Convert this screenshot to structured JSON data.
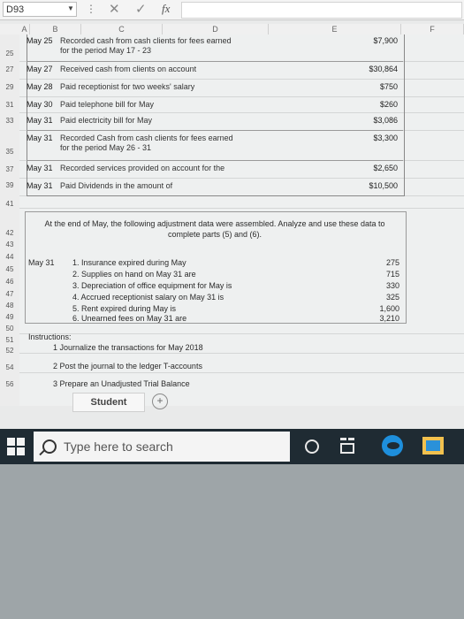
{
  "formula_bar": {
    "cell_ref": "D93",
    "dots": "⋮",
    "cancel_symbol": "✕",
    "enter_symbol": "✓",
    "fx_label": "fx"
  },
  "columns": [
    "A",
    "B",
    "C",
    "D",
    "E",
    "F"
  ],
  "row_numbers": [
    "25",
    "27",
    "29",
    "31",
    "33",
    "35",
    "37",
    "39",
    "41",
    "42",
    "43",
    "44",
    "45",
    "46",
    "47",
    "48",
    "49",
    "50",
    "51",
    "52",
    "54",
    "56"
  ],
  "transactions": [
    {
      "date": "May 25",
      "desc_1": "Recorded cash from cash clients for fees earned",
      "desc_2": "for the period May 17 - 23",
      "amount": "$7,900"
    },
    {
      "date": "May 27",
      "desc_1": "Received cash from clients on account",
      "desc_2": "",
      "amount": "$30,864"
    },
    {
      "date": "May 28",
      "desc_1": "Paid receptionist for two weeks' salary",
      "desc_2": "",
      "amount": "$750"
    },
    {
      "date": "May 30",
      "desc_1": "Paid telephone bill for May",
      "desc_2": "",
      "amount": "$260"
    },
    {
      "date": "May 31",
      "desc_1": "Paid electricity bill for May",
      "desc_2": "",
      "amount": "$3,086"
    },
    {
      "date": "May 31",
      "desc_1": "Recorded Cash from cash clients for fees earned",
      "desc_2": "for the period May 26 - 31",
      "amount": "$3,300"
    },
    {
      "date": "May 31",
      "desc_1": "Recorded services provided on account for the",
      "desc_2": "",
      "amount": "$2,650"
    },
    {
      "date": "May 31",
      "desc_1": "Paid Dividends in the amount of",
      "desc_2": "",
      "amount": "$10,500"
    }
  ],
  "adjustments": {
    "intro_1": "At the end of May, the following adjustment data were assembled. Analyze and use these data to",
    "intro_2": "complete parts (5) and (6).",
    "date": "May 31",
    "items": [
      {
        "label": "1. Insurance expired during May",
        "amount": "275"
      },
      {
        "label": "2. Supplies on hand on May 31 are",
        "amount": "715"
      },
      {
        "label": "3. Depreciation of office equipment for May is",
        "amount": "330"
      },
      {
        "label": "4. Accrued receptionist salary on May 31 is",
        "amount": "325"
      },
      {
        "label": "5. Rent expired during May is",
        "amount": "1,600"
      },
      {
        "label": "6. Unearned fees on May 31 are",
        "amount": "3,210"
      }
    ]
  },
  "instructions": {
    "title": "Instructions:",
    "items": [
      "1 Journalize the transactions for May 2018",
      "2 Post the journal to the ledger T-accounts",
      "3 Prepare an Unadjusted Trial Balance"
    ]
  },
  "sheet_tab": {
    "label": "Student",
    "add_symbol": "+"
  },
  "taskbar": {
    "search_placeholder": "Type here to search"
  },
  "colors": {
    "taskbar": "#1f2b33",
    "sheet_bg": "#eef0f0",
    "edge_blue": "#1e8fdc",
    "explorer_yellow": "#f2c14e"
  }
}
